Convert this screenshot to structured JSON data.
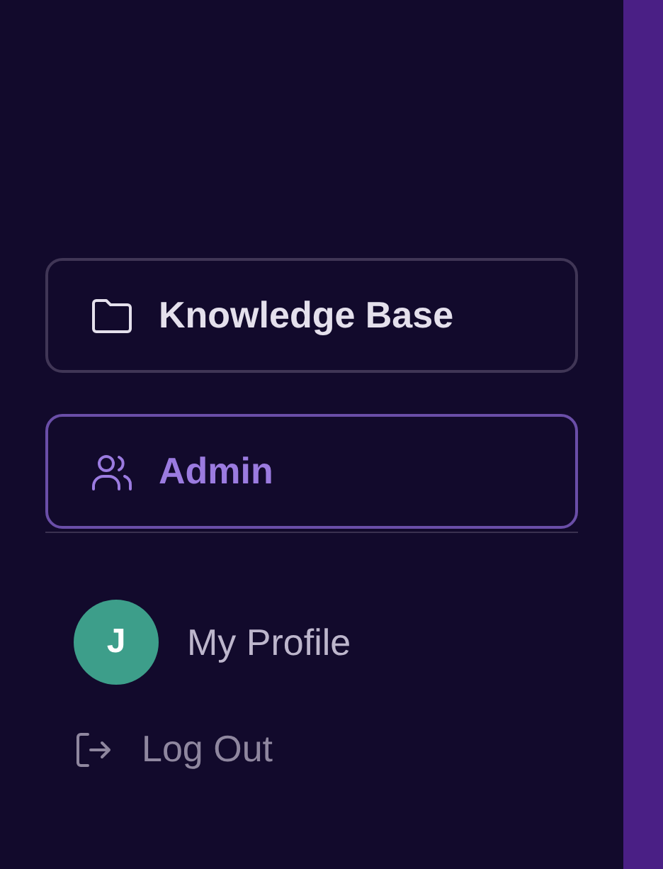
{
  "nav_items": [
    {
      "label": "Knowledge Base",
      "kind": "folder",
      "selected": false
    },
    {
      "label": "Admin",
      "kind": "users",
      "selected": true
    }
  ],
  "profile": {
    "avatar_initial": "J",
    "label": "My Profile"
  },
  "logout": {
    "label": "Log Out"
  }
}
